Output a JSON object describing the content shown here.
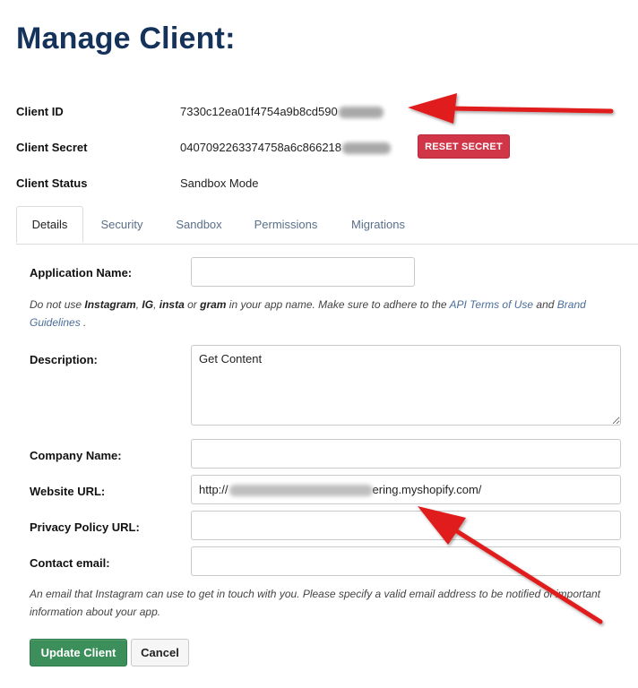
{
  "page": {
    "title": "Manage Client:"
  },
  "client": {
    "id_label": "Client ID",
    "id_value": "7330c12ea01f4754a9b8cd590",
    "secret_label": "Client Secret",
    "secret_value": "0407092263374758a6c866218",
    "reset_secret_label": "RESET SECRET",
    "status_label": "Client Status",
    "status_value": "Sandbox Mode"
  },
  "tabs": [
    {
      "label": "Details",
      "active": true
    },
    {
      "label": "Security"
    },
    {
      "label": "Sandbox"
    },
    {
      "label": "Permissions"
    },
    {
      "label": "Migrations"
    }
  ],
  "form": {
    "app_name_label": "Application Name:",
    "app_name_value": "",
    "name_help": {
      "p1": "Do not use ",
      "b1": "Instagram",
      "p2": ", ",
      "b2": "IG",
      "p3": ", ",
      "b3": "insta",
      "p4": " or ",
      "b4": "gram",
      "p5": " in your app name. Make sure to adhere to the ",
      "link1": "API Terms of Use",
      "p6": " and ",
      "link2": "Brand Guidelines",
      "p7": " ."
    },
    "description_label": "Description:",
    "description_value": "Get Content",
    "company_label": "Company Name:",
    "company_value": "",
    "website_label": "Website URL:",
    "website_prefix": "http://",
    "website_suffix": "ering.myshopify.com/",
    "privacy_label": "Privacy Policy URL:",
    "privacy_value": "",
    "email_label": "Contact email:",
    "email_value": "",
    "email_help": "An email that Instagram can use to get in touch with you. Please specify a valid email address to be notified of important information about your app."
  },
  "actions": {
    "update_label": "Update Client",
    "cancel_label": "Cancel"
  },
  "colors": {
    "title": "#14325a",
    "reset_button": "#d13648",
    "primary_button": "#3c8f5a",
    "link": "#4a6e9b",
    "annotation_arrow": "#e01b1b"
  }
}
